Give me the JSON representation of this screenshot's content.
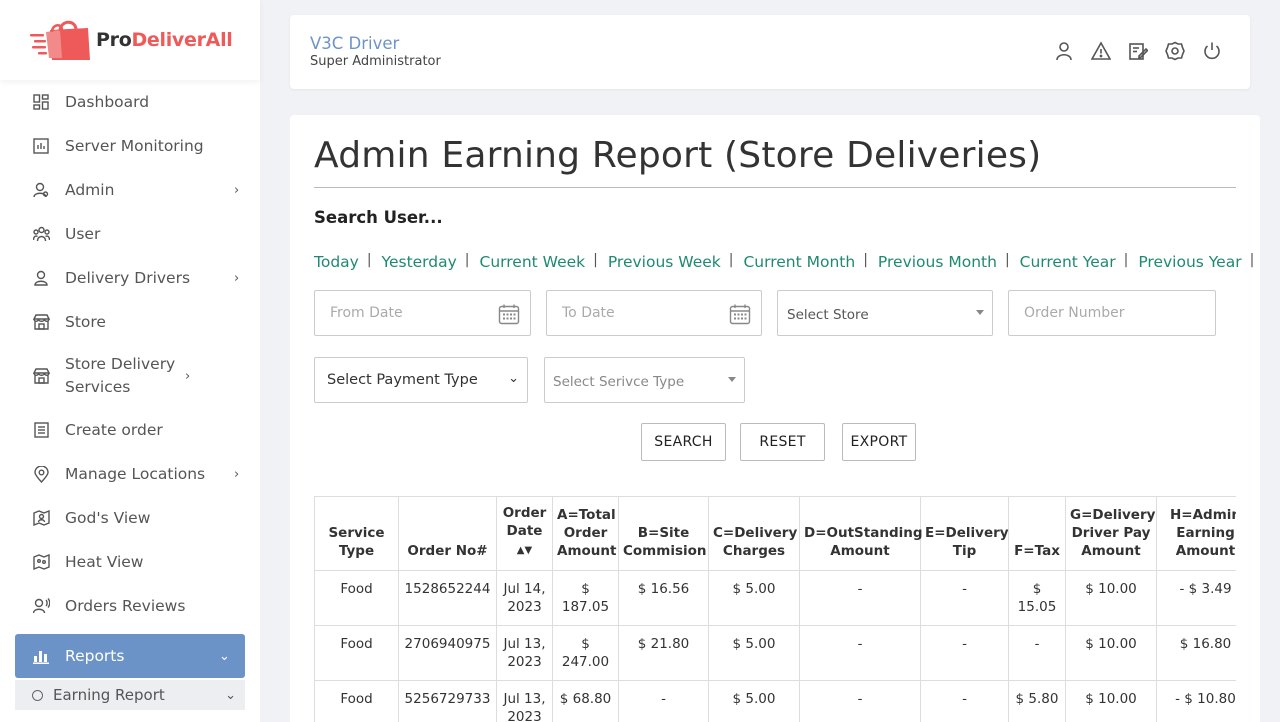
{
  "brand": {
    "name_part1": "Pro",
    "name_part2": "DeliverAll",
    "accent_color": "#ee5a5a"
  },
  "sidebar": {
    "items": [
      {
        "label": "Dashboard",
        "icon": "dashboard-icon"
      },
      {
        "label": "Server Monitoring",
        "icon": "chart-icon"
      },
      {
        "label": "Admin",
        "icon": "admin-user-icon",
        "has_submenu": true
      },
      {
        "label": "User",
        "icon": "users-icon"
      },
      {
        "label": "Delivery Drivers",
        "icon": "driver-icon",
        "has_submenu": true
      },
      {
        "label": "Store",
        "icon": "store-icon"
      },
      {
        "label": "Store Delivery Services",
        "icon": "store-icon",
        "has_submenu": true
      },
      {
        "label": "Create order",
        "icon": "order-list-icon"
      },
      {
        "label": "Manage Locations",
        "icon": "location-pin-icon",
        "has_submenu": true
      },
      {
        "label": "God's View",
        "icon": "map-user-icon"
      },
      {
        "label": "Heat View",
        "icon": "heat-map-icon"
      },
      {
        "label": "Orders Reviews",
        "icon": "review-user-icon"
      },
      {
        "label": "Reports",
        "icon": "bar-chart-icon",
        "active": true,
        "expanded": true
      }
    ],
    "submenu": {
      "label": "Earning Report"
    },
    "active_color": "#6b93c8"
  },
  "header": {
    "user_name": "V3C Driver",
    "user_role": "Super Administrator",
    "icons": [
      "profile-icon",
      "alert-icon",
      "edit-icon",
      "settings-icon",
      "power-icon"
    ]
  },
  "main": {
    "title": "Admin Earning Report (Store Deliveries)",
    "search_label": "Search User...",
    "quick_links": [
      "Today",
      "Yesterday",
      "Current Week",
      "Previous Week",
      "Current Month",
      "Previous Month",
      "Current Year",
      "Previous Year"
    ],
    "filters": {
      "from_date_placeholder": "From Date",
      "to_date_placeholder": "To Date",
      "store_select": "Select Store",
      "order_number_placeholder": "Order Number",
      "payment_type": "Select Payment Type",
      "service_type": "Select Serivce Type"
    },
    "buttons": {
      "search": "SEARCH",
      "reset": "RESET",
      "export": "EXPORT"
    }
  },
  "table": {
    "headers": [
      [
        "Service",
        "Type"
      ],
      [
        "Order No#"
      ],
      [
        "Order",
        "Date"
      ],
      [
        "A=Total",
        "Order",
        "Amount"
      ],
      [
        "B=Site",
        "Commision"
      ],
      [
        "C=Delivery",
        "Charges"
      ],
      [
        "D=OutStanding",
        "Amount"
      ],
      [
        "E=Delivery",
        "Tip"
      ],
      [
        "F=Tax"
      ],
      [
        "G=Delivery",
        "Driver Pay",
        "Amount"
      ],
      [
        "H=Admin",
        "Earning",
        "Amount"
      ]
    ],
    "rows": [
      [
        "Food",
        "1528652244",
        "Jul 14, 2023",
        "$ 187.05",
        "$ 16.56",
        "$ 5.00",
        "-",
        "-",
        "$ 15.05",
        "$ 10.00",
        "- $ 3.49"
      ],
      [
        "Food",
        "2706940975",
        "Jul 13, 2023",
        "$ 247.00",
        "$ 21.80",
        "$ 5.00",
        "-",
        "-",
        "-",
        "$ 10.00",
        "$ 16.80"
      ],
      [
        "Food",
        "5256729733",
        "Jul 13, 2023",
        "$ 68.80",
        "-",
        "$ 5.00",
        "-",
        "-",
        "$ 5.80",
        "$ 10.00",
        "- $ 10.80"
      ]
    ]
  }
}
